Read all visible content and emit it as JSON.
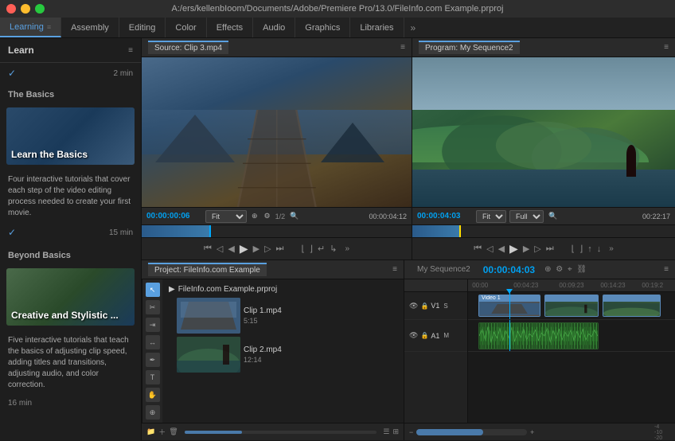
{
  "titleBar": {
    "text": "A:/ers/kellenbIoom/Documents/Adobe/Premiere Pro/13.0/FileInfo.com Example.prproj"
  },
  "tabs": [
    {
      "label": "Learning",
      "active": true,
      "dots": "≡"
    },
    {
      "label": "Assembly",
      "active": false
    },
    {
      "label": "Editing",
      "active": false
    },
    {
      "label": "Color",
      "active": false
    },
    {
      "label": "Effects",
      "active": false
    },
    {
      "label": "Audio",
      "active": false
    },
    {
      "label": "Graphics",
      "active": false
    },
    {
      "label": "Libraries",
      "active": false
    },
    {
      "label": "»",
      "active": false
    }
  ],
  "sidebar": {
    "header": "Learn",
    "headerIcons": "≡",
    "checkItem": {
      "checkMark": "✓",
      "time": "2 min"
    },
    "sections": [
      {
        "title": "The Basics",
        "card": {
          "label": "Learn the Basics",
          "description": "Four interactive tutorials that cover each step of the video editing process needed to create your first movie.",
          "time": "15 min"
        }
      },
      {
        "title": "Beyond Basics",
        "card": {
          "label": "Creative and Stylistic ...",
          "description": "Five interactive tutorials that teach the basics of adjusting clip speed, adding titles and transitions, adjusting audio, and color correction.",
          "time": "16 min"
        }
      }
    ]
  },
  "sourcePanel": {
    "title": "Source: Clip 3.mp4",
    "menuIcon": "≡",
    "timecode": "00:00:00:06",
    "fit": "Fit",
    "fraction": "1/2",
    "duration": "00:00:04:12"
  },
  "programPanel": {
    "title": "Program: My Sequence2",
    "menuIcon": "≡",
    "timecode": "00:00:04:03",
    "fit": "Fit",
    "quality": "Full",
    "duration": "00:22:17"
  },
  "projectPanel": {
    "title": "Project: FileInfo.com Example",
    "menuIcon": "≡",
    "rootFile": "FileInfo.com Example.prproj",
    "clips": [
      {
        "name": "Clip 1.mp4",
        "duration": "5:15",
        "type": "dock"
      },
      {
        "name": "Clip 2.mp4",
        "duration": "12:14",
        "type": "person"
      }
    ]
  },
  "timelinePanel": {
    "title": "My Sequence2",
    "menuIcon": "≡",
    "timecode": "00:00:04:03",
    "rulerMarks": [
      "00:00",
      "00:04:23",
      "00:09:23",
      "00:14:23",
      "00:19:2"
    ],
    "tracks": [
      {
        "label": "V1",
        "type": "video"
      },
      {
        "label": "A1",
        "type": "audio"
      }
    ],
    "clips": [
      {
        "track": "V1",
        "left": "5%",
        "width": "35%",
        "type": "dock",
        "label": "Video 1"
      },
      {
        "track": "V1",
        "left": "42%",
        "width": "30%",
        "type": "person",
        "label": ""
      },
      {
        "track": "V1",
        "left": "75%",
        "width": "22%",
        "type": "person",
        "label": ""
      }
    ]
  },
  "icons": {
    "check": "✓",
    "play": "▶",
    "pause": "⏸",
    "stepBack": "⏮",
    "stepForward": "⏭",
    "frameBack": "◀",
    "frameForward": "▶",
    "loop": "↺",
    "folder": "📁",
    "arrow": "▶",
    "cursor": "↖",
    "razor": "✂",
    "text": "T",
    "pen": "✒",
    "hand": "✋",
    "zoom": "🔍",
    "ripple": "⇥",
    "link": "⛓",
    "mute": "🔇",
    "lock": "🔒"
  }
}
